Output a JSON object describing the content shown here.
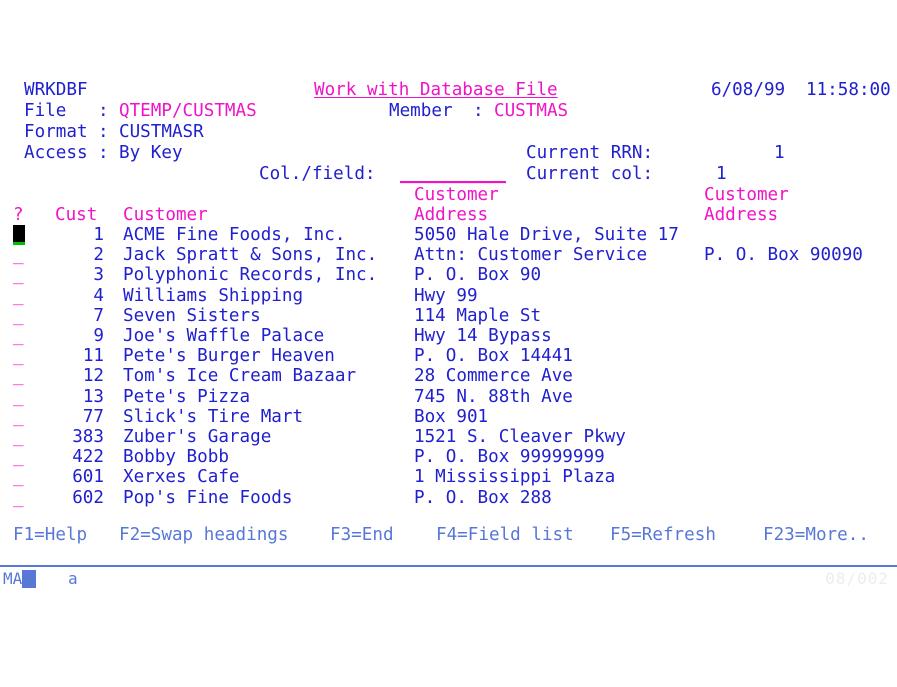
{
  "terminal": {
    "emulator_screen": "5250",
    "colors": {
      "blue": "#2020cf",
      "magenta": "#f013c8",
      "light_blue": "#5878d8",
      "background": "#ffffff",
      "cursor": "#000000",
      "cursor_underline": "#00c000",
      "status_grey": "#ededed"
    }
  },
  "header": {
    "program_name": "WRKDBF",
    "title": "Work with Database File",
    "date": "6/08/99",
    "time": "11:58:00",
    "file_label": "File",
    "file_sep": ":",
    "file_value": "QTEMP/CUSTMAS",
    "member_label": "Member",
    "member_sep": ":",
    "member_value": "CUSTMAS",
    "format_label": "Format",
    "format_sep": ":",
    "format_value": "CUSTMASR",
    "access_label": "Access",
    "access_sep": ":",
    "access_value": "By Key",
    "col_field_label": "Col./field:",
    "col_field_value": "",
    "col_field_underscores": "__________",
    "current_rrn_label": "Current RRN:",
    "current_rrn_value": "1",
    "current_col_label": "Current col:",
    "current_col_value": "1"
  },
  "table": {
    "headers": {
      "option": "?",
      "cust_line1": "",
      "cust_line2": "Cust",
      "customer_line1": "",
      "customer_line2": "Customer",
      "address1_line1": "Customer",
      "address1_line2": "Address",
      "address2_line1": "Customer",
      "address2_line2": "Address"
    },
    "option_marker": "_",
    "rows": [
      {
        "option": "",
        "cust": "1",
        "customer": "ACME Fine Foods, Inc.",
        "address1": "5050 Hale Drive, Suite 17",
        "address2": "",
        "cursor": true
      },
      {
        "option": "_",
        "cust": "2",
        "customer": "Jack Spratt & Sons, Inc.",
        "address1": "Attn: Customer Service",
        "address2": "P. O. Box 90090",
        "cursor": false
      },
      {
        "option": "_",
        "cust": "3",
        "customer": "Polyphonic Records, Inc.",
        "address1": "P. O. Box 90",
        "address2": "",
        "cursor": false
      },
      {
        "option": "_",
        "cust": "4",
        "customer": "Williams Shipping",
        "address1": "Hwy 99",
        "address2": "",
        "cursor": false
      },
      {
        "option": "_",
        "cust": "7",
        "customer": "Seven Sisters",
        "address1": "114 Maple St",
        "address2": "",
        "cursor": false
      },
      {
        "option": "_",
        "cust": "9",
        "customer": "Joe's Waffle Palace",
        "address1": "Hwy 14 Bypass",
        "address2": "",
        "cursor": false
      },
      {
        "option": "_",
        "cust": "11",
        "customer": "Pete's Burger Heaven",
        "address1": "P. O. Box 14441",
        "address2": "",
        "cursor": false
      },
      {
        "option": "_",
        "cust": "12",
        "customer": "Tom's Ice Cream Bazaar",
        "address1": "28 Commerce Ave",
        "address2": "",
        "cursor": false
      },
      {
        "option": "_",
        "cust": "13",
        "customer": "Pete's Pizza",
        "address1": "745 N. 88th Ave",
        "address2": "",
        "cursor": false
      },
      {
        "option": "_",
        "cust": "77",
        "customer": "Slick's Tire Mart",
        "address1": "Box 901",
        "address2": "",
        "cursor": false
      },
      {
        "option": "_",
        "cust": "383",
        "customer": "Zuber's Garage",
        "address1": "1521 S. Cleaver Pkwy",
        "address2": "",
        "cursor": false
      },
      {
        "option": "_",
        "cust": "422",
        "customer": "Bobby Bobb",
        "address1": "P. O. Box 99999999",
        "address2": "",
        "cursor": false
      },
      {
        "option": "_",
        "cust": "601",
        "customer": "Xerxes Cafe",
        "address1": "1 Mississippi Plaza",
        "address2": "",
        "cursor": false
      },
      {
        "option": "_",
        "cust": "602",
        "customer": "Pop's Fine Foods",
        "address1": "P. O. Box 288",
        "address2": "",
        "cursor": false
      }
    ]
  },
  "function_keys": {
    "f1": "F1=Help",
    "f2": "F2=Swap headings",
    "f3": "F3=End",
    "f4": "F4=Field list",
    "f5": "F5=Refresh",
    "f23": "F23=More.."
  },
  "status_bar": {
    "system_indicator": "MA",
    "input_mode": "a",
    "cursor_position": "08/002"
  }
}
